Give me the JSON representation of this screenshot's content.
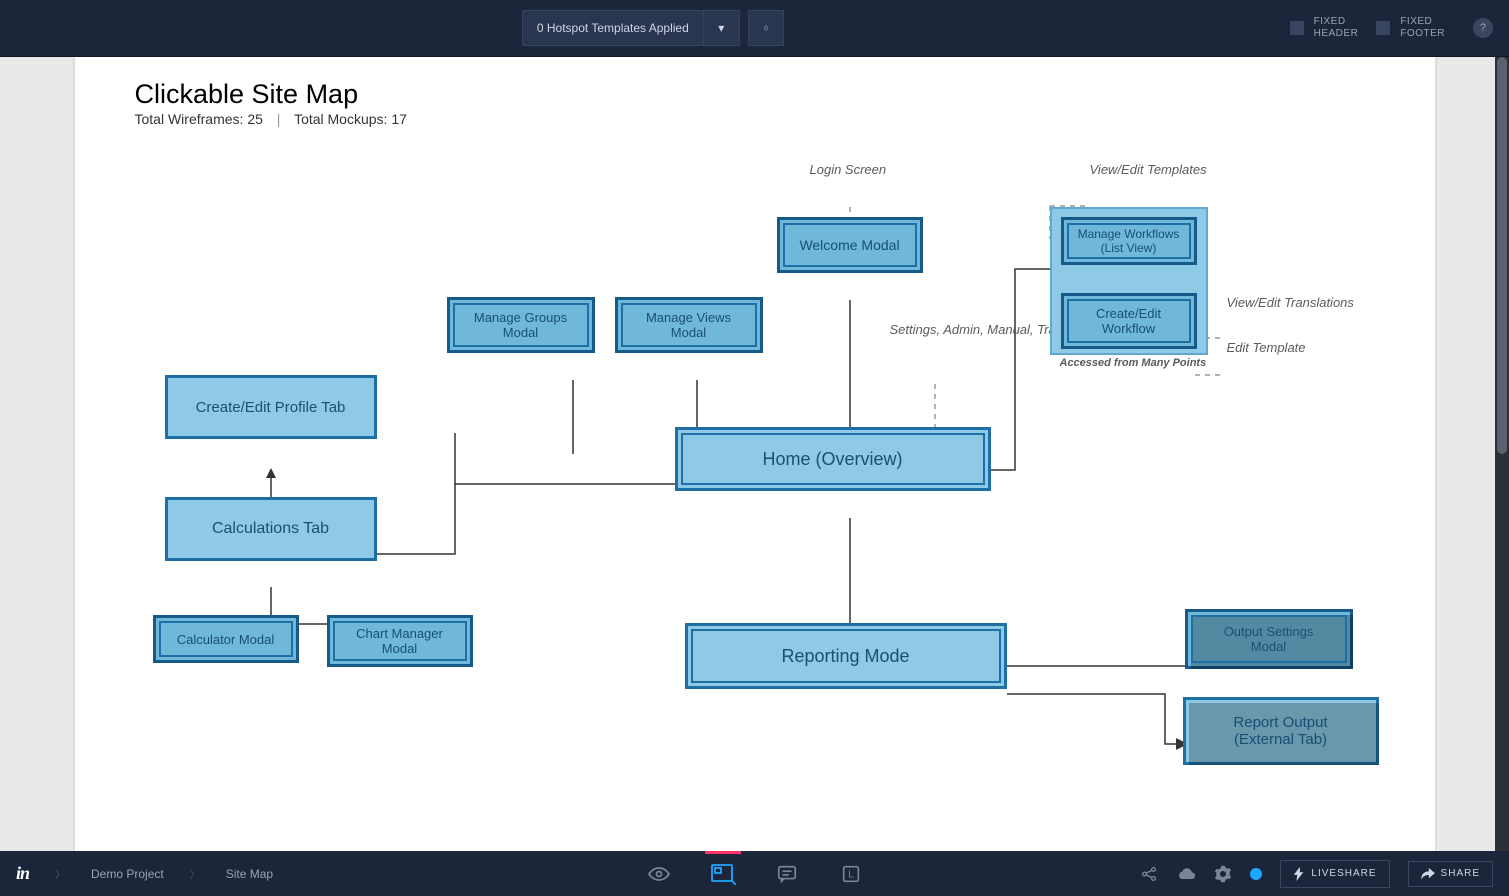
{
  "topbar": {
    "hotspot_label": "0 Hotspot Templates Applied",
    "fixed_header_label": "FIXED\nHEADER",
    "fixed_footer_label": "FIXED\nFOOTER",
    "help": "?"
  },
  "page": {
    "title": "Clickable Site Map",
    "wireframes_label": "Total Wireframes:",
    "wireframes_count": "25",
    "mockups_label": "Total Mockups:",
    "mockups_count": "17"
  },
  "nodes": {
    "welcome_modal": "Welcome Modal",
    "manage_workflows": "Manage Workflows\n(List View)",
    "create_edit_workflow": "Create/Edit\nWorkflow",
    "manage_groups": "Manage Groups\nModal",
    "manage_views": "Manage Views\nModal",
    "home": "Home (Overview)",
    "create_edit_profile": "Create/Edit Profile Tab",
    "calculations_tab": "Calculations Tab",
    "calculator_modal": "Calculator Modal",
    "chart_manager_modal": "Chart Manager\nModal",
    "reporting_mode": "Reporting Mode",
    "output_settings_modal": "Output Settings\nModal",
    "report_output": "Report Output\n(External Tab)"
  },
  "notes": {
    "login_screen": "Login Screen",
    "view_edit_templates": "View/Edit\nTemplates",
    "view_edit_translations": "View/Edit\nTranslations",
    "edit_template": "Edit Template",
    "accessed_many": "Accessed from Many Points",
    "settings_admin": "Settings, Admin,\nManual, Training"
  },
  "bottombar": {
    "logo": "in",
    "crumb_project": "Demo Project",
    "crumb_page": "Site Map",
    "liveshare": "LIVESHARE",
    "share": "SHARE"
  }
}
